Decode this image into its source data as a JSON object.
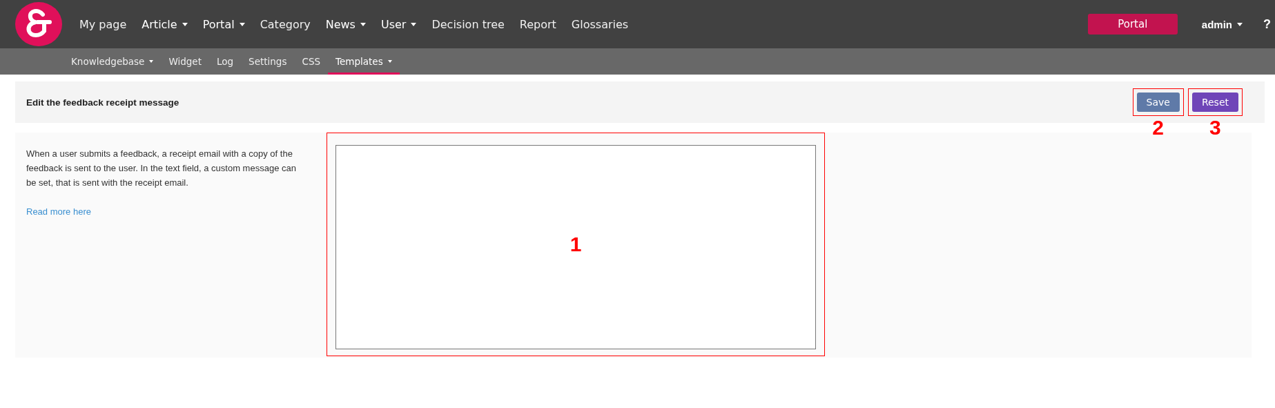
{
  "nav": {
    "items": [
      {
        "label": "My page",
        "dropdown": false
      },
      {
        "label": "Article",
        "dropdown": true
      },
      {
        "label": "Portal",
        "dropdown": true
      },
      {
        "label": "Category",
        "dropdown": false
      },
      {
        "label": "News",
        "dropdown": true
      },
      {
        "label": "User",
        "dropdown": true
      },
      {
        "label": "Decision tree",
        "dropdown": false
      },
      {
        "label": "Report",
        "dropdown": false
      },
      {
        "label": "Glossaries",
        "dropdown": false
      }
    ],
    "portal_button": "Portal",
    "user_menu": "admin",
    "help": "?"
  },
  "subnav": {
    "items": [
      {
        "label": "Knowledgebase",
        "dropdown": true,
        "selected": false
      },
      {
        "label": "Widget",
        "dropdown": false,
        "selected": false
      },
      {
        "label": "Log",
        "dropdown": false,
        "selected": false
      },
      {
        "label": "Settings",
        "dropdown": false,
        "selected": false
      },
      {
        "label": "CSS",
        "dropdown": false,
        "selected": false
      },
      {
        "label": "Templates",
        "dropdown": true,
        "selected": true
      }
    ]
  },
  "panel": {
    "title": "Edit the feedback receipt message",
    "buttons": [
      {
        "label": "Save",
        "kind": "save",
        "annotation": "2"
      },
      {
        "label": "Reset",
        "kind": "reset",
        "annotation": "3"
      }
    ]
  },
  "content": {
    "description": "When a user submits a feedback, a receipt email with a copy of the feedback is sent to the user. In the text field, a custom message can be set, that is sent with the receipt email.",
    "link": "Read more here",
    "editor": {
      "annotation": "1"
    }
  }
}
